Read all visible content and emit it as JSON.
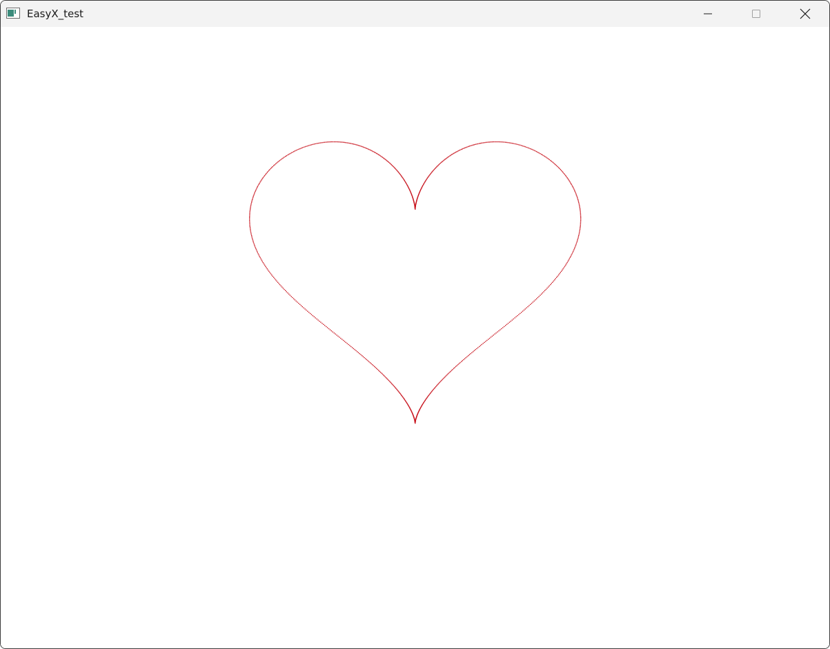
{
  "window": {
    "title": "EasyX_test",
    "icon": "app-window-icon",
    "controls": {
      "minimize_icon": "minimize-icon",
      "maximize_icon": "maximize-icon",
      "close_icon": "close-icon"
    }
  },
  "canvas": {
    "background": "#ffffff",
    "stroke_color": "#c8141e",
    "shape": "heart",
    "style": "dotted"
  }
}
